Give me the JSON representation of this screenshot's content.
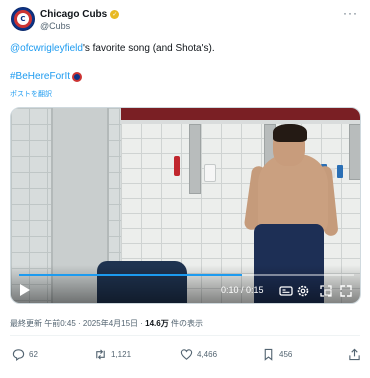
{
  "header": {
    "display_name": "Chicago Cubs",
    "handle": "@Cubs",
    "avatar_initials": "C",
    "more_label": "···"
  },
  "tweet": {
    "mention": "@ofcwrigleyfield",
    "text_after_mention": "'s favorite song (and Shota's).",
    "hashtag": "#BeHereForIt",
    "translate_label": "ポストを翻訳"
  },
  "video": {
    "time_display": "0:10 / 0:15",
    "progress_fraction": 0.667
  },
  "meta": {
    "prefix": "最終更新 午前0:45 · 2025年4月15日 · ",
    "views_count": "14.6万",
    "views_suffix": " 件の表示"
  },
  "actions": {
    "replies": "62",
    "reposts": "1,121",
    "likes": "4,466",
    "bookmarks": "456"
  },
  "colors": {
    "accent": "#1d9bf0",
    "cubs_blue": "#0e3386",
    "cubs_red": "#cc3433",
    "muted": "#536471"
  }
}
